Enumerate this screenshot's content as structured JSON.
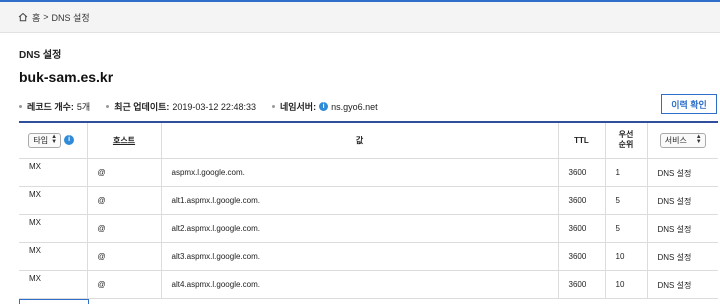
{
  "breadcrumb": {
    "home": "홈",
    "separator": ">",
    "current": "DNS 설정"
  },
  "page": {
    "section_title": "DNS 설정",
    "domain": "buk-sam.es.kr"
  },
  "info": {
    "record_count_label": "레코드 개수:",
    "record_count_value": "5개",
    "last_update_label": "최근 업데이트:",
    "last_update_value": "2019-03-12 22:48:33",
    "nameserver_label": "네임서버:",
    "nameserver_value": "ns.gyo6.net"
  },
  "history_button": "이력 확인",
  "table": {
    "headers": {
      "type_select": "타입",
      "host": "호스트",
      "value": "값",
      "ttl": "TTL",
      "priority_line1": "우선",
      "priority_line2": "순위",
      "service_select": "서비스"
    },
    "rows": [
      {
        "type": "MX",
        "host": "@",
        "value": "aspmx.l.google.com.",
        "ttl": "3600",
        "priority": "1",
        "service": "DNS 설정"
      },
      {
        "type": "MX",
        "host": "@",
        "value": "alt1.aspmx.l.google.com.",
        "ttl": "3600",
        "priority": "5",
        "service": "DNS 설정"
      },
      {
        "type": "MX",
        "host": "@",
        "value": "alt2.aspmx.l.google.com.",
        "ttl": "3600",
        "priority": "5",
        "service": "DNS 설정"
      },
      {
        "type": "MX",
        "host": "@",
        "value": "alt3.aspmx.l.google.com.",
        "ttl": "3600",
        "priority": "10",
        "service": "DNS 설정"
      },
      {
        "type": "MX",
        "host": "@",
        "value": "alt4.aspmx.l.google.com.",
        "ttl": "3600",
        "priority": "10",
        "service": "DNS 설정"
      }
    ]
  },
  "colors": {
    "accent": "#2f6fc9",
    "header_rule": "#2f4f9c",
    "info_icon": "#2f8bd8"
  },
  "icons": {
    "home": "home-icon",
    "info": "info-icon",
    "select_arrows": "select-arrows-icon"
  }
}
